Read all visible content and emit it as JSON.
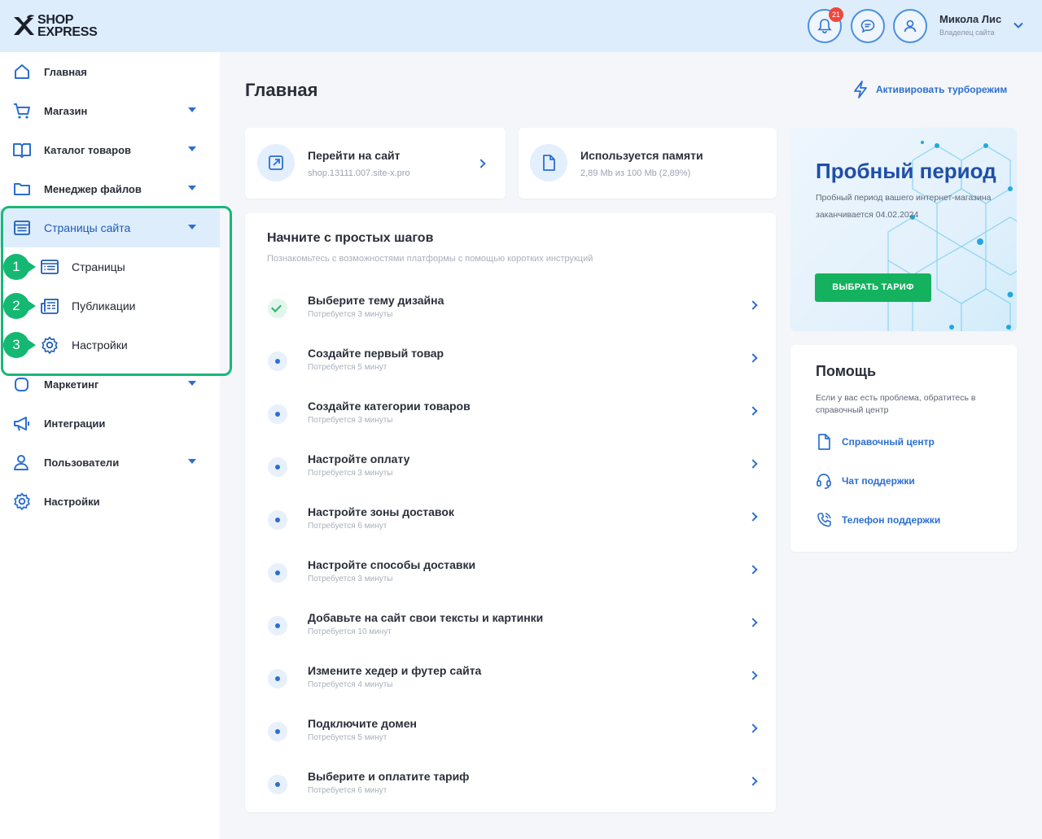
{
  "header": {
    "logo_line1": "SHOP",
    "logo_line2": "EXPRESS",
    "notifications_count": "21",
    "user_name": "Микола Лис",
    "user_role": "Владелец сайта"
  },
  "sidebar": {
    "items": [
      {
        "label": "Главная"
      },
      {
        "label": "Магазин"
      },
      {
        "label": "Каталог товаров"
      },
      {
        "label": "Менеджер файлов"
      },
      {
        "label": "Страницы сайта"
      },
      {
        "label": "Маркетинг"
      },
      {
        "label": "Интеграции"
      },
      {
        "label": "Пользователи"
      },
      {
        "label": "Настройки"
      }
    ],
    "subitems": [
      {
        "num": "1",
        "label": "Страницы"
      },
      {
        "num": "2",
        "label": "Публикации"
      },
      {
        "num": "3",
        "label": "Настройки"
      }
    ]
  },
  "main": {
    "title": "Главная",
    "turbo_label": "Активировать турборежим",
    "site_card": {
      "title": "Перейти на сайт",
      "sub": "shop.13111.007.site-x.pro"
    },
    "memory_card": {
      "title": "Используется памяти",
      "sub": "2,89 Mb из 100 Mb (2,89%)"
    },
    "steps": {
      "title": "Начните с простых шагов",
      "desc": "Познакомьтесь с возможностями платформы с помощью коротких инструкций",
      "items": [
        {
          "title": "Выберите тему дизайна",
          "time": "Потребуется 3 минуты"
        },
        {
          "title": "Создайте первый товар",
          "time": "Потребуется 5 минут"
        },
        {
          "title": "Создайте категории товаров",
          "time": "Потребуется 3 минуты"
        },
        {
          "title": "Настройте оплату",
          "time": "Потребуется 3 минуты"
        },
        {
          "title": "Настройте зоны доставок",
          "time": "Потребуется 6 минут"
        },
        {
          "title": "Настройте способы доставки",
          "time": "Потребуется 3 минуты"
        },
        {
          "title": "Добавьте на сайт свои тексты и картинки",
          "time": "Потребуется 10 минут"
        },
        {
          "title": "Измените хедер и футер сайта",
          "time": "Потребуется 4 минуты"
        },
        {
          "title": "Подключите домен",
          "time": "Потребуется 5 минут"
        },
        {
          "title": "Выберите и оплатите тариф",
          "time": "Потребуется 6 минут"
        }
      ]
    }
  },
  "trial": {
    "title": "Пробный период",
    "text": "Пробный период вашего интернет-магазина заканчивается 04.02.2024",
    "button": "ВЫБРАТЬ ТАРИФ"
  },
  "help": {
    "title": "Помощь",
    "desc": "Если у вас есть проблема, обратитесь в справочный центр",
    "links": [
      {
        "label": "Справочный центр"
      },
      {
        "label": "Чат поддержки"
      },
      {
        "label": "Телефон поддержки"
      }
    ]
  },
  "colors": {
    "accent": "#2c6fd1",
    "highlight": "#18b878",
    "cta": "#14b25f"
  }
}
